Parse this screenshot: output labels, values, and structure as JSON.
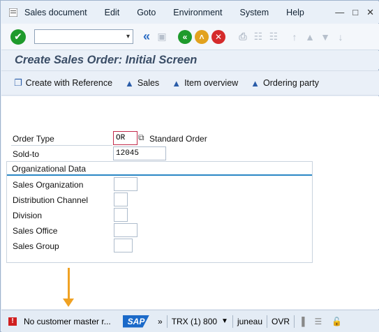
{
  "menubar": {
    "items": [
      "Sales document",
      "Edit",
      "Goto",
      "Environment",
      "System",
      "Help"
    ]
  },
  "toolbar": {
    "command_field_value": ""
  },
  "title": "Create Sales Order: Initial Screen",
  "app_toolbar": {
    "buttons": [
      "Create with Reference",
      "Sales",
      "Item overview",
      "Ordering party"
    ]
  },
  "form": {
    "order_type_label": "Order Type",
    "order_type_value": "OR",
    "order_type_desc": "Standard Order",
    "sold_to_label": "Sold-to",
    "sold_to_value": "12045",
    "org_data_title": "Organizational Data",
    "sales_org_label": "Sales Organization",
    "sales_org_value": "",
    "dist_channel_label": "Distribution Channel",
    "dist_channel_value": "",
    "division_label": "Division",
    "division_value": "",
    "sales_office_label": "Sales Office",
    "sales_office_value": "",
    "sales_group_label": "Sales Group",
    "sales_group_value": ""
  },
  "statusbar": {
    "message": "No customer master r...",
    "logo": "SAP",
    "expand": "»",
    "transaction": "TRX (1) 800",
    "server": "juneau",
    "mode": "OVR"
  },
  "colors": {
    "accent": "#2a87c5",
    "arrow": "#f0a223",
    "error": "#d01f1f",
    "ok": "#1e9a2c"
  }
}
